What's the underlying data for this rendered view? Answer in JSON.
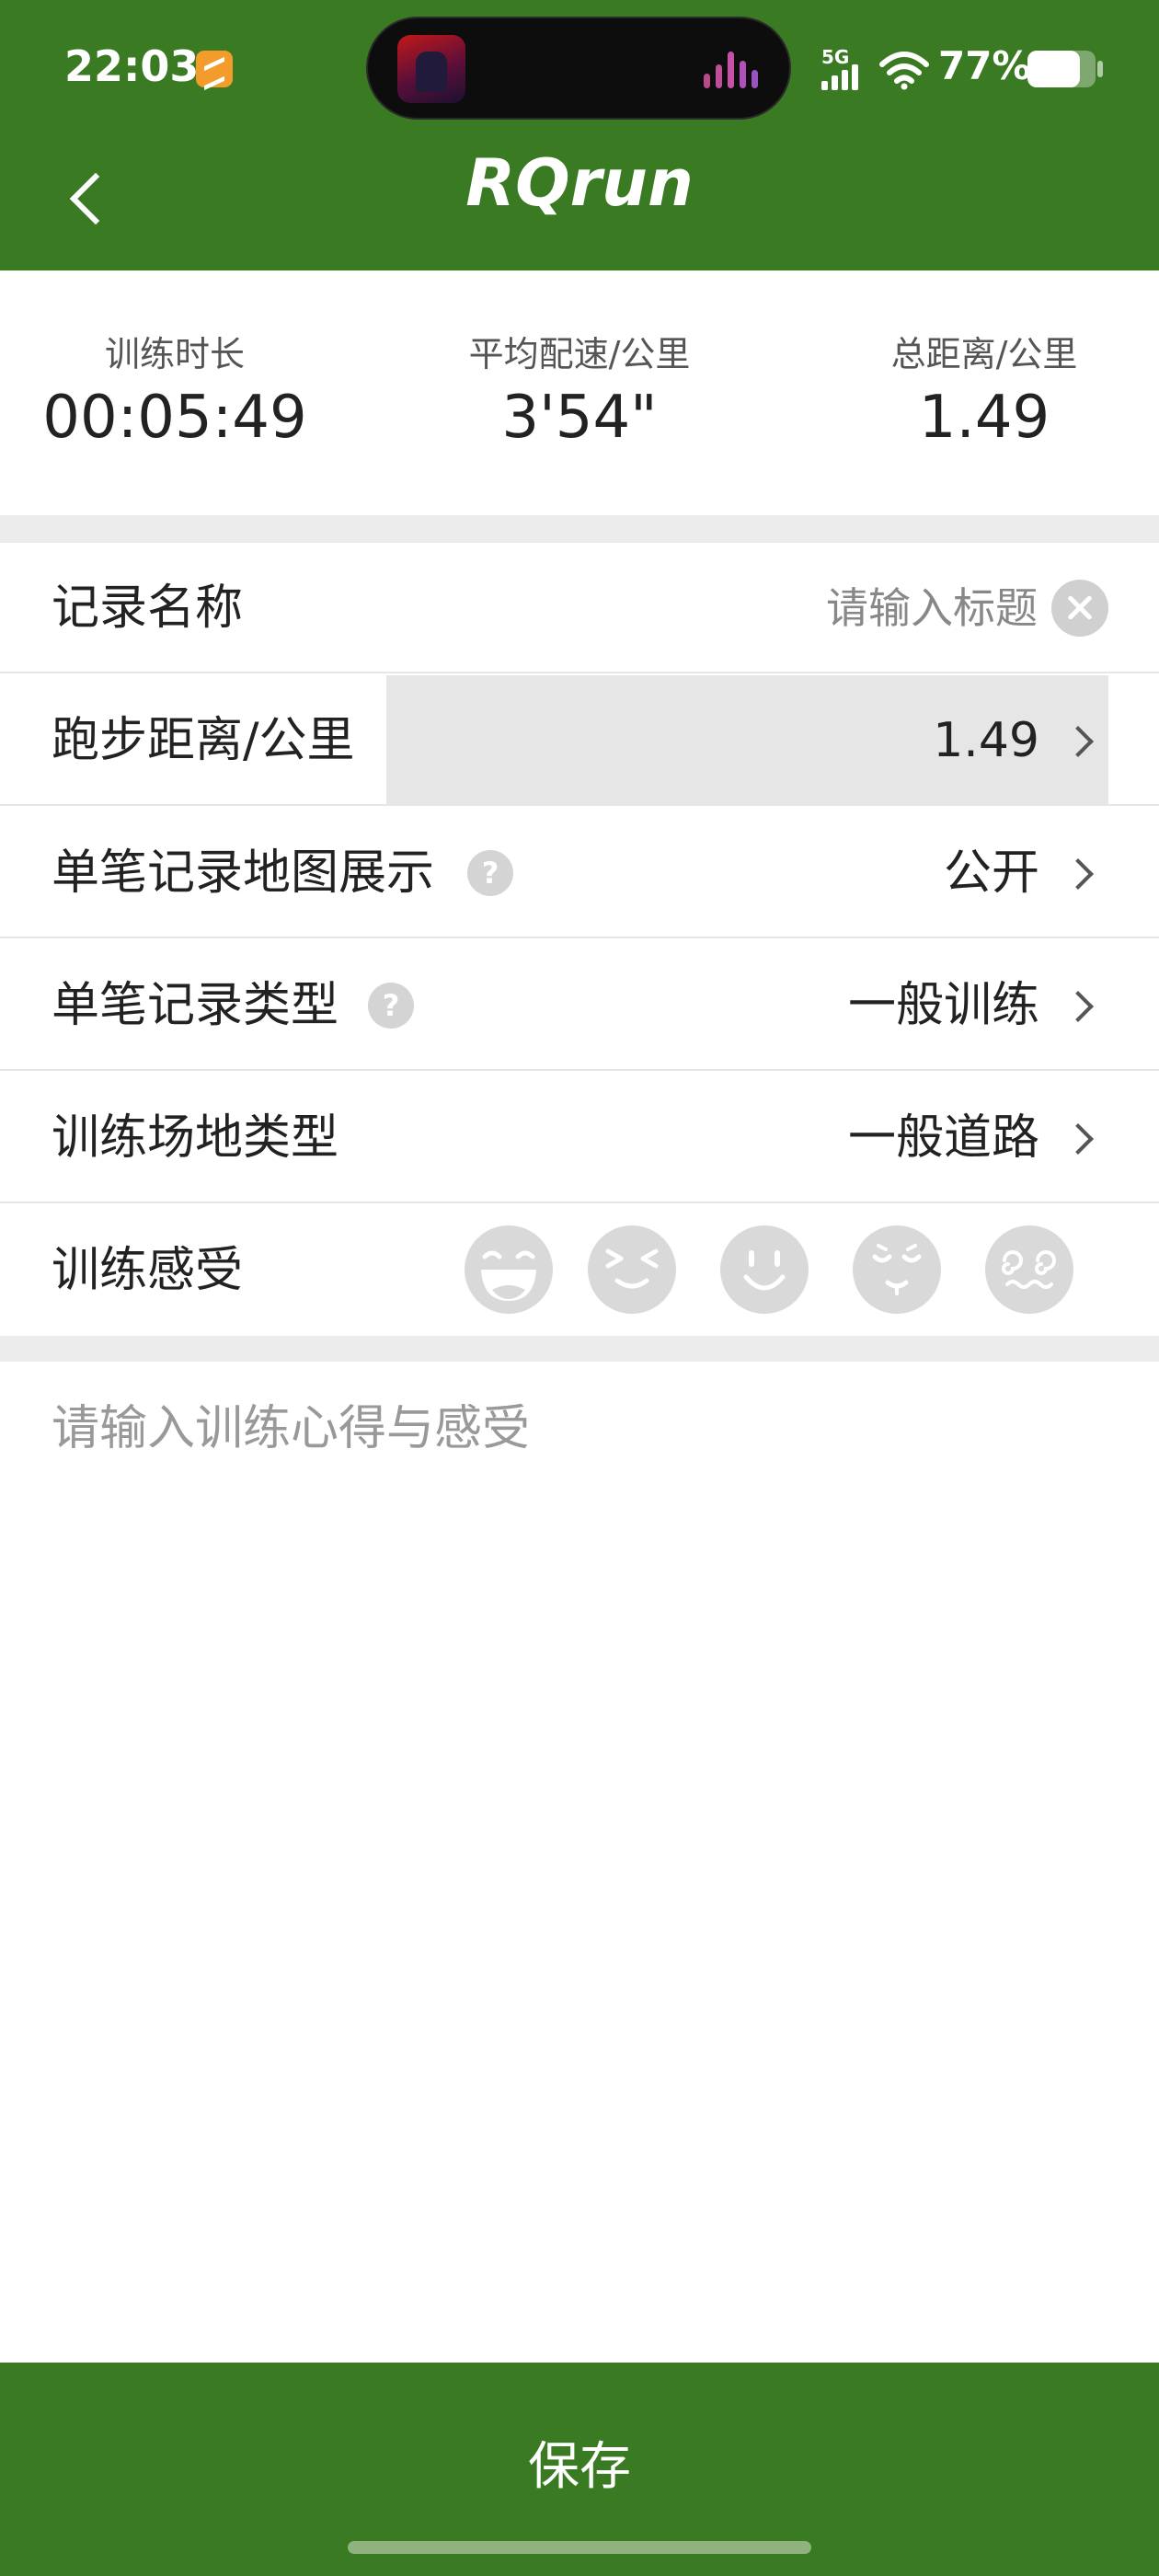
{
  "status_bar": {
    "time": "22:03",
    "network": "5G",
    "battery_percent_text": "77%",
    "battery_level": 0.77,
    "icons": [
      "notification-app-icon",
      "audio-wave-icon",
      "signal-icon",
      "wifi-icon",
      "battery-icon"
    ]
  },
  "nav": {
    "title": "RQrun",
    "back_icon": "chevron-left-icon"
  },
  "stats": [
    {
      "label": "训练时长",
      "value": "00:05:49"
    },
    {
      "label": "平均配速/公里",
      "value": "3'54\""
    },
    {
      "label": "总距离/公里",
      "value": "1.49"
    }
  ],
  "form": {
    "record_name": {
      "label": "记录名称",
      "placeholder": "请输入标题",
      "clear_icon": "close-icon"
    },
    "distance": {
      "label": "跑步距离/公里",
      "value": "1.49"
    },
    "map_display": {
      "label": "单笔记录地图展示",
      "value": "公开",
      "help_glyph": "?"
    },
    "record_type": {
      "label": "单笔记录类型",
      "value": "一般训练",
      "help_glyph": "?"
    },
    "venue_type": {
      "label": "训练场地类型",
      "value": "一般道路"
    },
    "feeling": {
      "label": "训练感受",
      "options": [
        "laughing-face-icon",
        "squint-face-icon",
        "smile-face-icon",
        "worried-face-icon",
        "dizzy-face-icon"
      ]
    }
  },
  "notes": {
    "placeholder": "请输入训练心得与感受"
  },
  "save_button": {
    "label": "保存"
  },
  "colors": {
    "brand_green": "#3a7a22",
    "divider": "#ebebeb",
    "emoji_gray": "#d9d9d9"
  }
}
